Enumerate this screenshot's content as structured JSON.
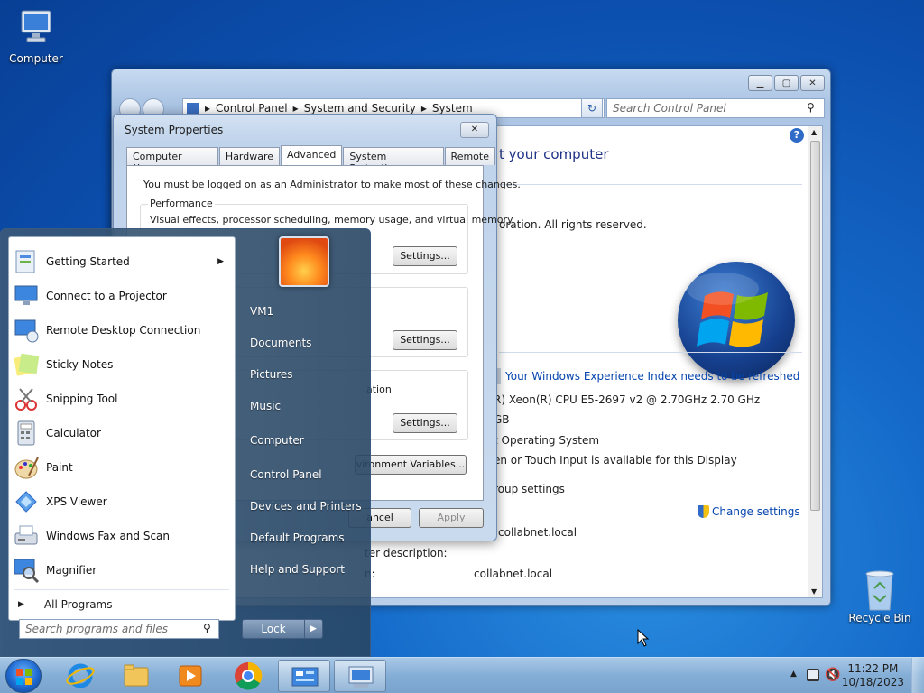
{
  "desktop": {
    "icons": [
      {
        "label": "Computer"
      },
      {
        "label": "Recycle Bin"
      }
    ]
  },
  "control_panel": {
    "breadcrumb": [
      "Control Panel",
      "System and Security",
      "System"
    ],
    "search_placeholder": "Search Control Panel",
    "heading": "t your computer",
    "copyright": "oration.  All rights reserved.",
    "experience_link": "Your Windows Experience Index needs to be refreshed",
    "processor": "R) Xeon(R) CPU E5-2697 v2 @ 2.70GHz   2.70 GHz",
    "memory": "GB",
    "system_type": "t Operating System",
    "pen_touch": "en or Touch Input is available for this Display",
    "group_settings": "roup settings",
    "change_settings": "Change settings",
    "full_name_value": "collabnet.local",
    "computer_description": "ter description:",
    "domain_label": "n:",
    "domain_value": "collabnet.local"
  },
  "system_properties": {
    "title": "System Properties",
    "tabs": [
      "Computer Name",
      "Hardware",
      "Advanced",
      "System Protection",
      "Remote"
    ],
    "active_tab": "Advanced",
    "admin_note": "You must be logged on as an Administrator to make most of these changes.",
    "performance_label": "Performance",
    "performance_desc": "Visual effects, processor scheduling, memory usage, and virtual memory",
    "settings_label": "Settings...",
    "startup_partial": "ation",
    "env_vars_label": "vironment Variables...",
    "cancel_label": "ancel",
    "apply_label": "Apply"
  },
  "start_menu": {
    "programs": [
      {
        "label": "Getting Started",
        "icon": "getting-started-icon",
        "has_submenu": true
      },
      {
        "label": "Connect to a Projector",
        "icon": "projector-icon"
      },
      {
        "label": "Remote Desktop Connection",
        "icon": "remote-desktop-icon"
      },
      {
        "label": "Sticky Notes",
        "icon": "sticky-notes-icon"
      },
      {
        "label": "Snipping Tool",
        "icon": "snipping-tool-icon"
      },
      {
        "label": "Calculator",
        "icon": "calculator-icon"
      },
      {
        "label": "Paint",
        "icon": "paint-icon"
      },
      {
        "label": "XPS Viewer",
        "icon": "xps-viewer-icon"
      },
      {
        "label": "Windows Fax and Scan",
        "icon": "fax-scan-icon"
      },
      {
        "label": "Magnifier",
        "icon": "magnifier-icon"
      }
    ],
    "all_programs": "All Programs",
    "search_placeholder": "Search programs and files",
    "right_items": [
      "VM1",
      "Documents",
      "Pictures",
      "Music",
      "Computer",
      "Control Panel",
      "Devices and Printers",
      "Default Programs",
      "Help and Support"
    ],
    "lock_label": "Lock"
  },
  "taskbar": {
    "time": "11:22 PM",
    "date": "10/18/2023"
  }
}
